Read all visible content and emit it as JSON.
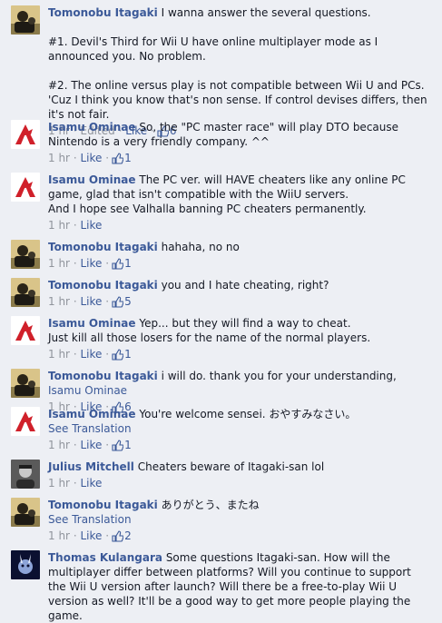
{
  "meta": {
    "dot": "·",
    "edited_label": "Edited",
    "like_label": "Like"
  },
  "comments": [
    {
      "author": "Tomonobu Itagaki",
      "paragraphs": [
        "I wanna answer the several questions.",
        "#1. Devil's Third for Wii U have online multiplayer mode as I announced you. No problem.",
        "#2. The online versus play is not compatible between Wii U and PCs. 'Cuz I think you know that's non sense. If control devises differs, then it's not fair."
      ],
      "time": "1 hr",
      "edited": true,
      "likes": "6"
    },
    {
      "author": "Isamu Ominae",
      "paragraphs": [
        "So, the \"PC master race\" will play DTO because Nintendo is a very friendly company. ^^"
      ],
      "time": "1 hr",
      "likes": "1"
    },
    {
      "author": "Isamu Ominae",
      "paragraphs": [
        "The PC ver. will HAVE cheaters like any online PC game, glad that isn't compatible with the WiiU servers.",
        "And I hope see Valhalla banning PC cheaters permanently."
      ],
      "time": "1 hr",
      "likes": ""
    },
    {
      "author": "Tomonobu Itagaki",
      "paragraphs": [
        "hahaha, no no"
      ],
      "time": "1 hr",
      "likes": "1"
    },
    {
      "author": "Tomonobu Itagaki",
      "paragraphs": [
        "you and I hate cheating, right?"
      ],
      "time": "1 hr",
      "likes": "5"
    },
    {
      "author": "Isamu Ominae",
      "paragraphs": [
        "Yep... but they will find a way to cheat.",
        "Just kill all those losers for the name of the normal players."
      ],
      "time": "1 hr",
      "likes": "1"
    },
    {
      "author": "Tomonobu Itagaki",
      "paragraphs": [
        "i will do. thank you for your understanding,"
      ],
      "mention": "Isamu Ominae",
      "time": "1 hr",
      "likes": "6"
    },
    {
      "author": "Isamu Ominae",
      "paragraphs": [
        "You're welcome sensei. おやすみなさい。"
      ],
      "see_translation": "See Translation",
      "time": "1 hr",
      "likes": "1"
    },
    {
      "author": "Julius Mitchell",
      "paragraphs": [
        "Cheaters beware of Itagaki-san lol"
      ],
      "time": "1 hr",
      "likes": ""
    },
    {
      "author": "Tomonobu Itagaki",
      "paragraphs": [
        "ありがとう、またね"
      ],
      "see_translation": "See Translation",
      "time": "1 hr",
      "likes": "2"
    },
    {
      "author": "Thomas Kulangara",
      "paragraphs": [
        "Some questions Itagaki-san. How will the multiplayer differ between platforms? Will you continue to support the Wii U version after launch? Will there be a free-to-play Wii U version as well? It'll be a good way to get more people playing the game."
      ],
      "time": "",
      "likes": ""
    }
  ],
  "colors": {
    "link": "#3b5998",
    "meta": "#90949c",
    "background": "#edeff4",
    "text": "#141823"
  }
}
